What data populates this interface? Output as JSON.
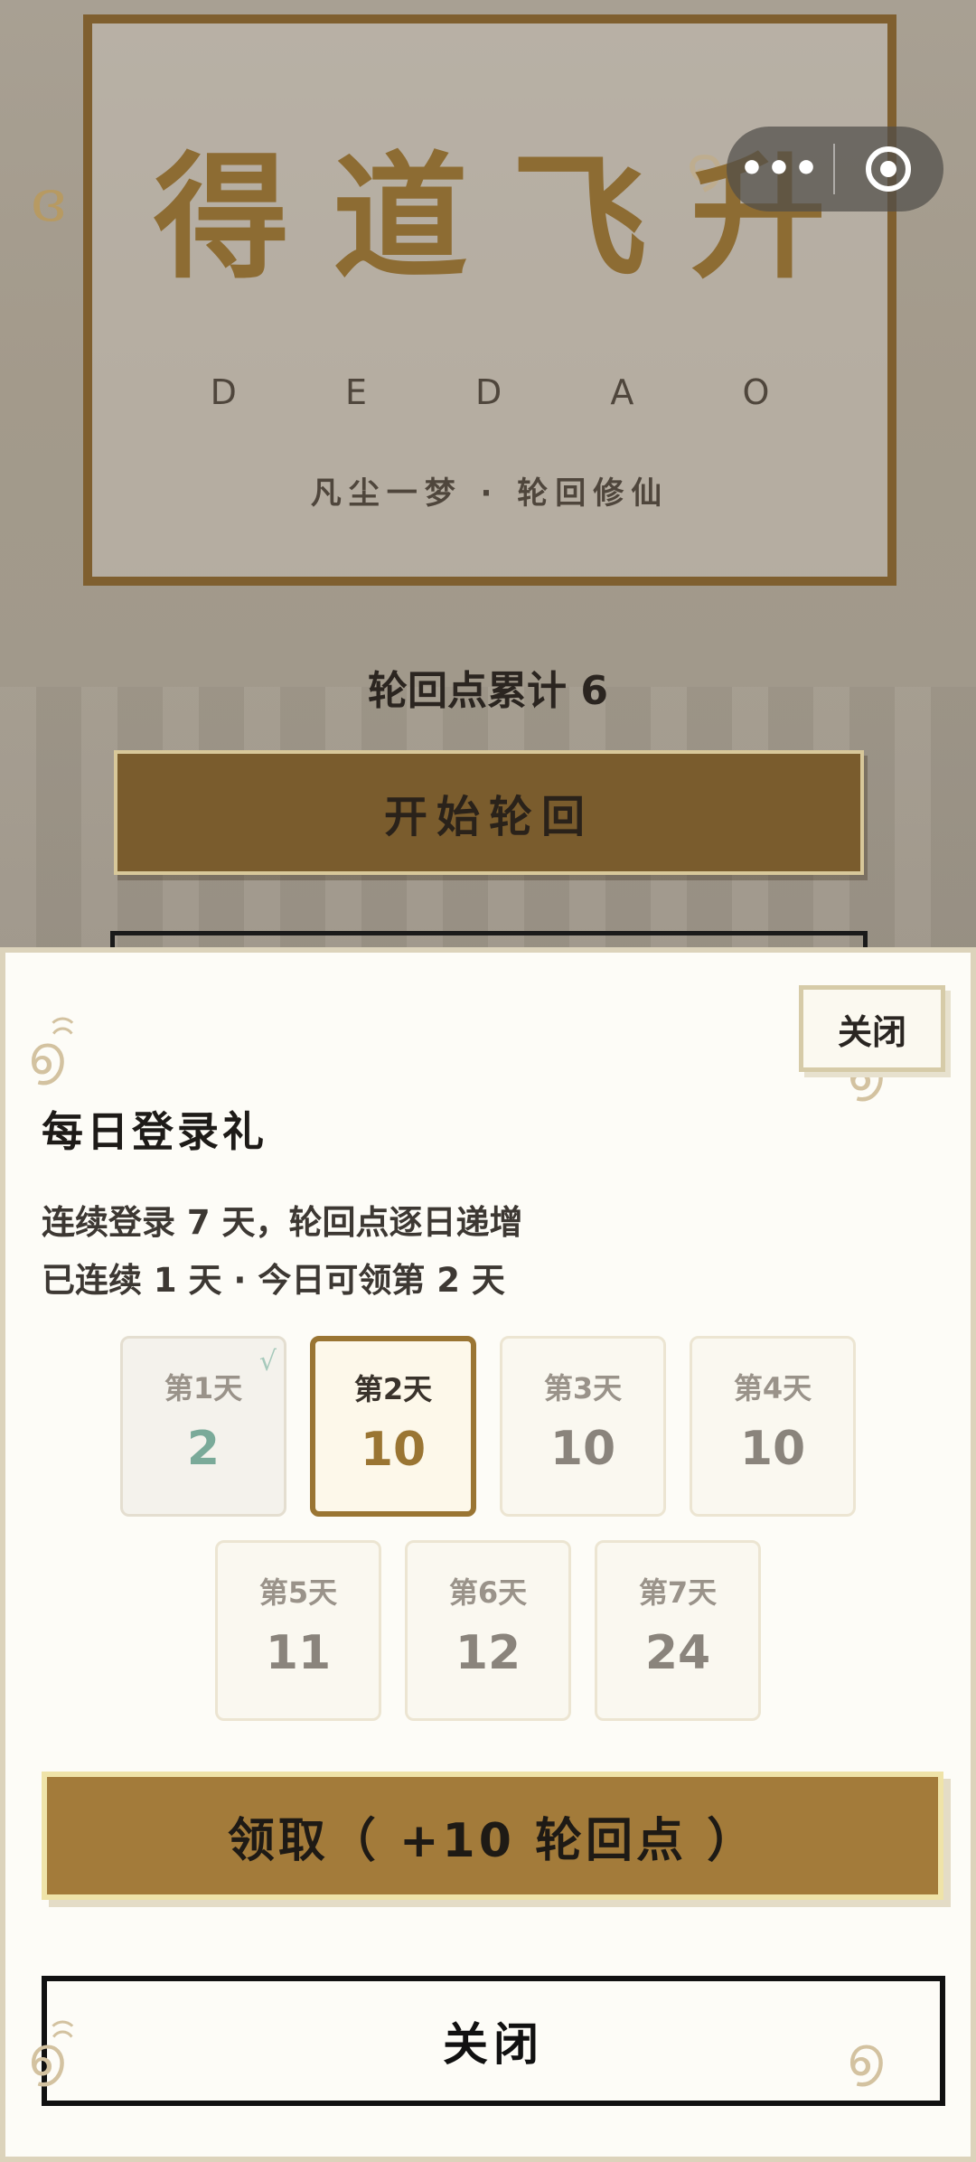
{
  "background": {
    "title": "得道飞升",
    "subtitle": "D E D A O",
    "tagline": "凡尘一梦 · 轮回修仙",
    "points_line": "轮回点累计 6",
    "start_button": "开始轮回"
  },
  "capsule": {
    "more_icon": "•••",
    "target_icon": "record-icon"
  },
  "modal": {
    "close_top_label": "关闭",
    "title": "每日登录礼",
    "desc_line1": "连续登录 7 天，轮回点逐日递增",
    "desc_line2": "已连续 1 天 · 今日可领第 2 天",
    "days": [
      {
        "label": "第1天",
        "value": "2",
        "status": "claimed",
        "check": "√"
      },
      {
        "label": "第2天",
        "value": "10",
        "status": "current"
      },
      {
        "label": "第3天",
        "value": "10",
        "status": "locked"
      },
      {
        "label": "第4天",
        "value": "10",
        "status": "locked"
      },
      {
        "label": "第5天",
        "value": "11",
        "status": "locked"
      },
      {
        "label": "第6天",
        "value": "12",
        "status": "locked"
      },
      {
        "label": "第7天",
        "value": "24",
        "status": "locked"
      }
    ],
    "claim_button": "领取（ +10 轮回点 ）",
    "close_bottom_label": "关闭"
  },
  "colors": {
    "accent": "#a37b3a",
    "frame": "#7f5f2f",
    "claimed_value": "#7aaa99"
  }
}
